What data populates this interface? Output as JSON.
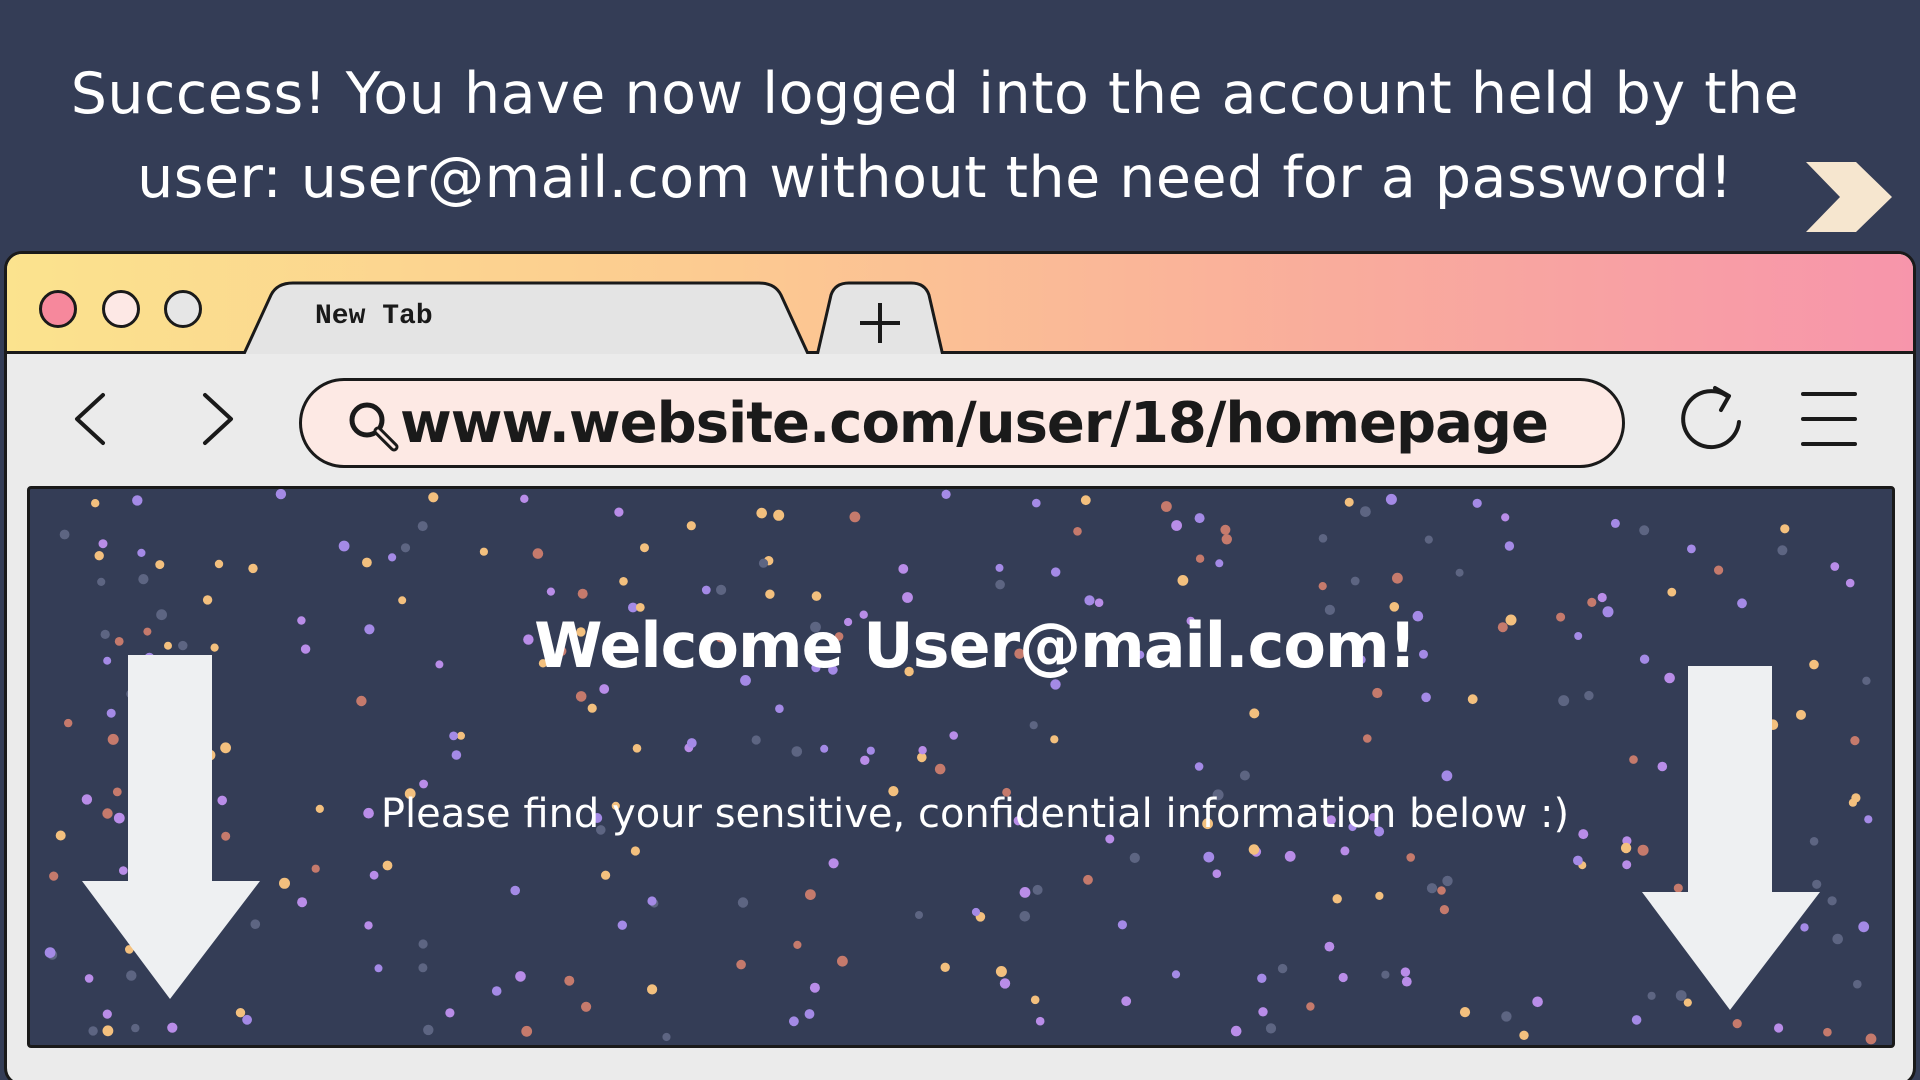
{
  "banner": {
    "headline_line1": "Success! You have now logged into the account held by the",
    "headline_line2": "user: user@mail.com without the need for a password!",
    "next_icon": "chevron-right-icon"
  },
  "browser": {
    "window_controls": [
      "close",
      "minimize",
      "maximize"
    ],
    "colors": {
      "titlebar_gradient": [
        "#fbe38e",
        "#fcca91",
        "#f9ac9c",
        "#f795ab"
      ],
      "close": "#f6889c",
      "minimize": "#fde8e5",
      "maximize": "#e6e6e6",
      "url_bar": "#fde9e4",
      "page_background": "#343d56"
    },
    "tabs": [
      {
        "label": "New Tab"
      }
    ],
    "new_tab_icon": "plus-icon",
    "toolbar": {
      "back_icon": "chevron-left-icon",
      "forward_icon": "chevron-right-icon",
      "search_icon": "magnifier-icon",
      "url": "www.website.com/user/18/homepage",
      "reload_icon": "reload-icon",
      "menu_icon": "hamburger-menu-icon"
    }
  },
  "page": {
    "welcome_title": "Welcome User@mail.com!",
    "message": "Please find your sensitive, confidential information below :)",
    "decor_icons": [
      "down-arrow-icon",
      "down-arrow-icon"
    ]
  }
}
